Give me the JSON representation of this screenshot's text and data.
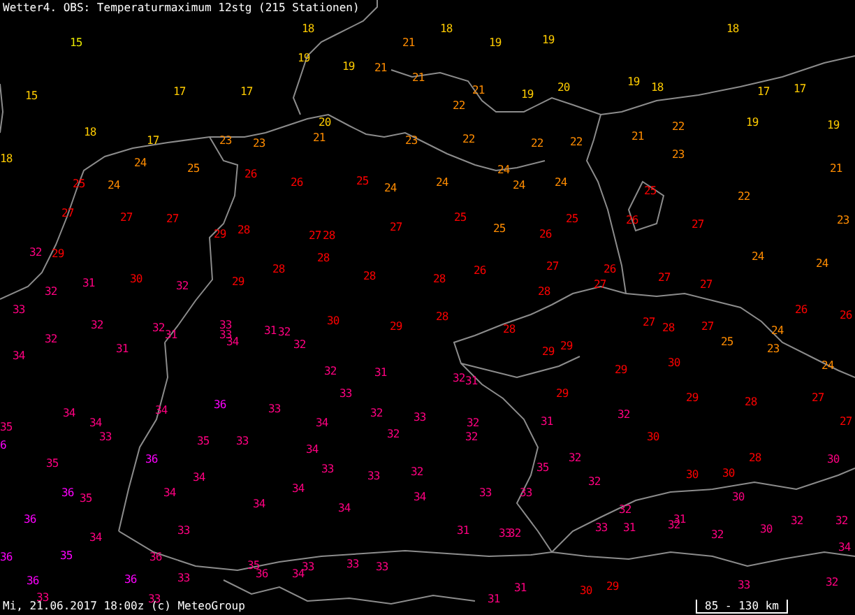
{
  "title": "Wetter4. OBS: Temperaturmaximum 12stg (215 Stationen)",
  "stations": [
    {
      "value": "18",
      "color": "#ffcc00"
    },
    {
      "value": "18",
      "color": "#ffcc00"
    },
    {
      "value": "18",
      "color": "#ffcc00"
    },
    {
      "value": "15",
      "color": "#e6e600"
    },
    {
      "value": "21",
      "color": "#ff8c00"
    },
    {
      "value": "19",
      "color": "#ffcc00"
    },
    {
      "value": "19",
      "color": "#ffcc00"
    },
    {
      "value": "19",
      "color": "#ffcc00"
    },
    {
      "value": "19",
      "color": "#ffcc00"
    },
    {
      "value": "21",
      "color": "#ff8c00"
    },
    {
      "value": "15",
      "color": "#ffcc00"
    },
    {
      "value": "17",
      "color": "#ffcc00"
    },
    {
      "value": "17",
      "color": "#ffcc00"
    },
    {
      "value": "21",
      "color": "#ff8c00"
    },
    {
      "value": "21",
      "color": "#ff8c00"
    },
    {
      "value": "19",
      "color": "#ffcc00"
    },
    {
      "value": "20",
      "color": "#ffcc00"
    },
    {
      "value": "19",
      "color": "#ffcc00"
    },
    {
      "value": "18",
      "color": "#ffcc00"
    },
    {
      "value": "17",
      "color": "#ffcc00"
    },
    {
      "value": "17",
      "color": "#ffcc00"
    },
    {
      "value": "22",
      "color": "#ff8c00"
    },
    {
      "value": "18",
      "color": "#ffcc00"
    },
    {
      "value": "20",
      "color": "#ffcc00"
    },
    {
      "value": "22",
      "color": "#ff8c00"
    },
    {
      "value": "19",
      "color": "#ffcc00"
    },
    {
      "value": "19",
      "color": "#ffcc00"
    },
    {
      "value": "17",
      "color": "#ffcc00"
    },
    {
      "value": "23",
      "color": "#ff8c00"
    },
    {
      "value": "23",
      "color": "#ff8c00"
    },
    {
      "value": "21",
      "color": "#ff8c00"
    },
    {
      "value": "23",
      "color": "#ff8c00"
    },
    {
      "value": "22",
      "color": "#ff8c00"
    },
    {
      "value": "22",
      "color": "#ff8c00"
    },
    {
      "value": "22",
      "color": "#ff8c00"
    },
    {
      "value": "21",
      "color": "#ff8c00"
    },
    {
      "value": "18",
      "color": "#ffcc00"
    },
    {
      "value": "23",
      "color": "#ff8c00"
    },
    {
      "value": "24",
      "color": "#ff8c00"
    },
    {
      "value": "25",
      "color": "#ff8c00"
    },
    {
      "value": "26",
      "color": "#ff0000"
    },
    {
      "value": "24",
      "color": "#ff8c00"
    },
    {
      "value": "21",
      "color": "#ff8c00"
    },
    {
      "value": "25",
      "color": "#ff0000"
    },
    {
      "value": "24",
      "color": "#ff8c00"
    },
    {
      "value": "26",
      "color": "#ff0000"
    },
    {
      "value": "25",
      "color": "#ff0000"
    },
    {
      "value": "24",
      "color": "#ff8c00"
    },
    {
      "value": "24",
      "color": "#ff8c00"
    },
    {
      "value": "24",
      "color": "#ff8c00"
    },
    {
      "value": "24",
      "color": "#ff8c00"
    },
    {
      "value": "25",
      "color": "#ff0000"
    },
    {
      "value": "22",
      "color": "#ff8c00"
    },
    {
      "value": "27",
      "color": "#ff0000"
    },
    {
      "value": "27",
      "color": "#ff0000"
    },
    {
      "value": "27",
      "color": "#ff0000"
    },
    {
      "value": "25",
      "color": "#ff0000"
    },
    {
      "value": "25",
      "color": "#ff0000"
    },
    {
      "value": "26",
      "color": "#ff0000"
    },
    {
      "value": "23",
      "color": "#ff8c00"
    },
    {
      "value": "29",
      "color": "#ff0000"
    },
    {
      "value": "28",
      "color": "#ff0000"
    },
    {
      "value": "27",
      "color": "#ff0000"
    },
    {
      "value": "28",
      "color": "#ff0000"
    },
    {
      "value": "27",
      "color": "#ff0000"
    },
    {
      "value": "25",
      "color": "#ff8c00"
    },
    {
      "value": "26",
      "color": "#ff0000"
    },
    {
      "value": "27",
      "color": "#ff0000"
    },
    {
      "value": "32",
      "color": "#ff0080"
    },
    {
      "value": "29",
      "color": "#ff0000"
    },
    {
      "value": "28",
      "color": "#ff0000"
    },
    {
      "value": "24",
      "color": "#ff8c00"
    },
    {
      "value": "28",
      "color": "#ff0000"
    },
    {
      "value": "26",
      "color": "#ff0000"
    },
    {
      "value": "27",
      "color": "#ff0000"
    },
    {
      "value": "26",
      "color": "#ff0000"
    },
    {
      "value": "24",
      "color": "#ff8c00"
    },
    {
      "value": "31",
      "color": "#ff0080"
    },
    {
      "value": "30",
      "color": "#ff0000"
    },
    {
      "value": "32",
      "color": "#ff0080"
    },
    {
      "value": "29",
      "color": "#ff0000"
    },
    {
      "value": "28",
      "color": "#ff0000"
    },
    {
      "value": "28",
      "color": "#ff0000"
    },
    {
      "value": "27",
      "color": "#ff0000"
    },
    {
      "value": "27",
      "color": "#ff0000"
    },
    {
      "value": "27",
      "color": "#ff0000"
    },
    {
      "value": "32",
      "color": "#ff0080"
    },
    {
      "value": "28",
      "color": "#ff0000"
    },
    {
      "value": "33",
      "color": "#ff0080"
    },
    {
      "value": "28",
      "color": "#ff0000"
    },
    {
      "value": "26",
      "color": "#ff0000"
    },
    {
      "value": "26",
      "color": "#ff0000"
    },
    {
      "value": "32",
      "color": "#ff0080"
    },
    {
      "value": "32",
      "color": "#ff0080"
    },
    {
      "value": "33",
      "color": "#ff0080"
    },
    {
      "value": "31",
      "color": "#ff0080"
    },
    {
      "value": "32",
      "color": "#ff0080"
    },
    {
      "value": "30",
      "color": "#ff0000"
    },
    {
      "value": "29",
      "color": "#ff0000"
    },
    {
      "value": "28",
      "color": "#ff0000"
    },
    {
      "value": "27",
      "color": "#ff0000"
    },
    {
      "value": "28",
      "color": "#ff0000"
    },
    {
      "value": "27",
      "color": "#ff0000"
    },
    {
      "value": "24",
      "color": "#ff8c00"
    },
    {
      "value": "32",
      "color": "#ff0080"
    },
    {
      "value": "31",
      "color": "#ff0080"
    },
    {
      "value": "31",
      "color": "#ff0080"
    },
    {
      "value": "33",
      "color": "#ff0080"
    },
    {
      "value": "34",
      "color": "#ff0080"
    },
    {
      "value": "32",
      "color": "#ff0080"
    },
    {
      "value": "29",
      "color": "#ff0000"
    },
    {
      "value": "25",
      "color": "#ff8c00"
    },
    {
      "value": "23",
      "color": "#ff8c00"
    },
    {
      "value": "34",
      "color": "#ff0080"
    },
    {
      "value": "29",
      "color": "#ff0000"
    },
    {
      "value": "32",
      "color": "#ff0080"
    },
    {
      "value": "31",
      "color": "#ff0080"
    },
    {
      "value": "29",
      "color": "#ff0000"
    },
    {
      "value": "30",
      "color": "#ff0000"
    },
    {
      "value": "24",
      "color": "#ff8c00"
    },
    {
      "value": "32",
      "color": "#ff0080"
    },
    {
      "value": "31",
      "color": "#ff0080"
    },
    {
      "value": "33",
      "color": "#ff0080"
    },
    {
      "value": "29",
      "color": "#ff0000"
    },
    {
      "value": "29",
      "color": "#ff0000"
    },
    {
      "value": "27",
      "color": "#ff0000"
    },
    {
      "value": "34",
      "color": "#ff0080"
    },
    {
      "value": "34",
      "color": "#ff0080"
    },
    {
      "value": "36",
      "color": "#ff00ff"
    },
    {
      "value": "33",
      "color": "#ff0080"
    },
    {
      "value": "32",
      "color": "#ff0080"
    },
    {
      "value": "28",
      "color": "#ff0000"
    },
    {
      "value": "35",
      "color": "#ff0080"
    },
    {
      "value": "34",
      "color": "#ff0080"
    },
    {
      "value": "34",
      "color": "#ff0080"
    },
    {
      "value": "33",
      "color": "#ff0080"
    },
    {
      "value": "32",
      "color": "#ff0080"
    },
    {
      "value": "31",
      "color": "#ff0080"
    },
    {
      "value": "32",
      "color": "#ff0080"
    },
    {
      "value": "27",
      "color": "#ff0000"
    },
    {
      "value": "6",
      "color": "#ff00ff"
    },
    {
      "value": "33",
      "color": "#ff0080"
    },
    {
      "value": "35",
      "color": "#ff0080"
    },
    {
      "value": "33",
      "color": "#ff0080"
    },
    {
      "value": "32",
      "color": "#ff0080"
    },
    {
      "value": "32",
      "color": "#ff0080"
    },
    {
      "value": "30",
      "color": "#ff0000"
    },
    {
      "value": "34",
      "color": "#ff0080"
    },
    {
      "value": "35",
      "color": "#ff0080"
    },
    {
      "value": "36",
      "color": "#ff00ff"
    },
    {
      "value": "32",
      "color": "#ff0080"
    },
    {
      "value": "28",
      "color": "#ff0000"
    },
    {
      "value": "30",
      "color": "#ff0080"
    },
    {
      "value": "34",
      "color": "#ff0080"
    },
    {
      "value": "33",
      "color": "#ff0080"
    },
    {
      "value": "33",
      "color": "#ff0080"
    },
    {
      "value": "32",
      "color": "#ff0080"
    },
    {
      "value": "35",
      "color": "#ff0080"
    },
    {
      "value": "32",
      "color": "#ff0080"
    },
    {
      "value": "30",
      "color": "#ff0000"
    },
    {
      "value": "30",
      "color": "#ff0000"
    },
    {
      "value": "36",
      "color": "#ff00ff"
    },
    {
      "value": "35",
      "color": "#ff0080"
    },
    {
      "value": "34",
      "color": "#ff0080"
    },
    {
      "value": "34",
      "color": "#ff0080"
    },
    {
      "value": "34",
      "color": "#ff0080"
    },
    {
      "value": "33",
      "color": "#ff0080"
    },
    {
      "value": "33",
      "color": "#ff0080"
    },
    {
      "value": "30",
      "color": "#ff0080"
    },
    {
      "value": "34",
      "color": "#ff0080"
    },
    {
      "value": "34",
      "color": "#ff0080"
    },
    {
      "value": "32",
      "color": "#ff0080"
    },
    {
      "value": "36",
      "color": "#ff00ff"
    },
    {
      "value": "32",
      "color": "#ff0080"
    },
    {
      "value": "31",
      "color": "#ff0080"
    },
    {
      "value": "32",
      "color": "#ff0080"
    },
    {
      "value": "32",
      "color": "#ff0080"
    },
    {
      "value": "34",
      "color": "#ff0080"
    },
    {
      "value": "33",
      "color": "#ff0080"
    },
    {
      "value": "31",
      "color": "#ff0080"
    },
    {
      "value": "33",
      "color": "#ff0080"
    },
    {
      "value": "32",
      "color": "#ff0080"
    },
    {
      "value": "33",
      "color": "#ff0080"
    },
    {
      "value": "31",
      "color": "#ff0080"
    },
    {
      "value": "32",
      "color": "#ff0080"
    },
    {
      "value": "30",
      "color": "#ff0080"
    },
    {
      "value": "36",
      "color": "#ff00ff"
    },
    {
      "value": "35",
      "color": "#ff00ff"
    },
    {
      "value": "36",
      "color": "#ff0080"
    },
    {
      "value": "34",
      "color": "#ff0080"
    },
    {
      "value": "35",
      "color": "#ff0080"
    },
    {
      "value": "36",
      "color": "#ff0080"
    },
    {
      "value": "34",
      "color": "#ff0080"
    },
    {
      "value": "33",
      "color": "#ff0080"
    },
    {
      "value": "33",
      "color": "#ff0080"
    },
    {
      "value": "33",
      "color": "#ff0080"
    },
    {
      "value": "36",
      "color": "#ff00ff"
    },
    {
      "value": "36",
      "color": "#ff00ff"
    },
    {
      "value": "33",
      "color": "#ff0080"
    },
    {
      "value": "31",
      "color": "#ff0080"
    },
    {
      "value": "30",
      "color": "#ff0000"
    },
    {
      "value": "29",
      "color": "#ff0000"
    },
    {
      "value": "33",
      "color": "#ff0080"
    },
    {
      "value": "32",
      "color": "#ff0080"
    },
    {
      "value": "33",
      "color": "#ff0080"
    },
    {
      "value": "33",
      "color": "#ff0080"
    },
    {
      "value": "31",
      "color": "#ff0080"
    }
  ],
  "footer": "Mi, 21.06.2017 18:00z (c) MeteoGroup",
  "scale": {
    "label": "85 - 130 km"
  }
}
